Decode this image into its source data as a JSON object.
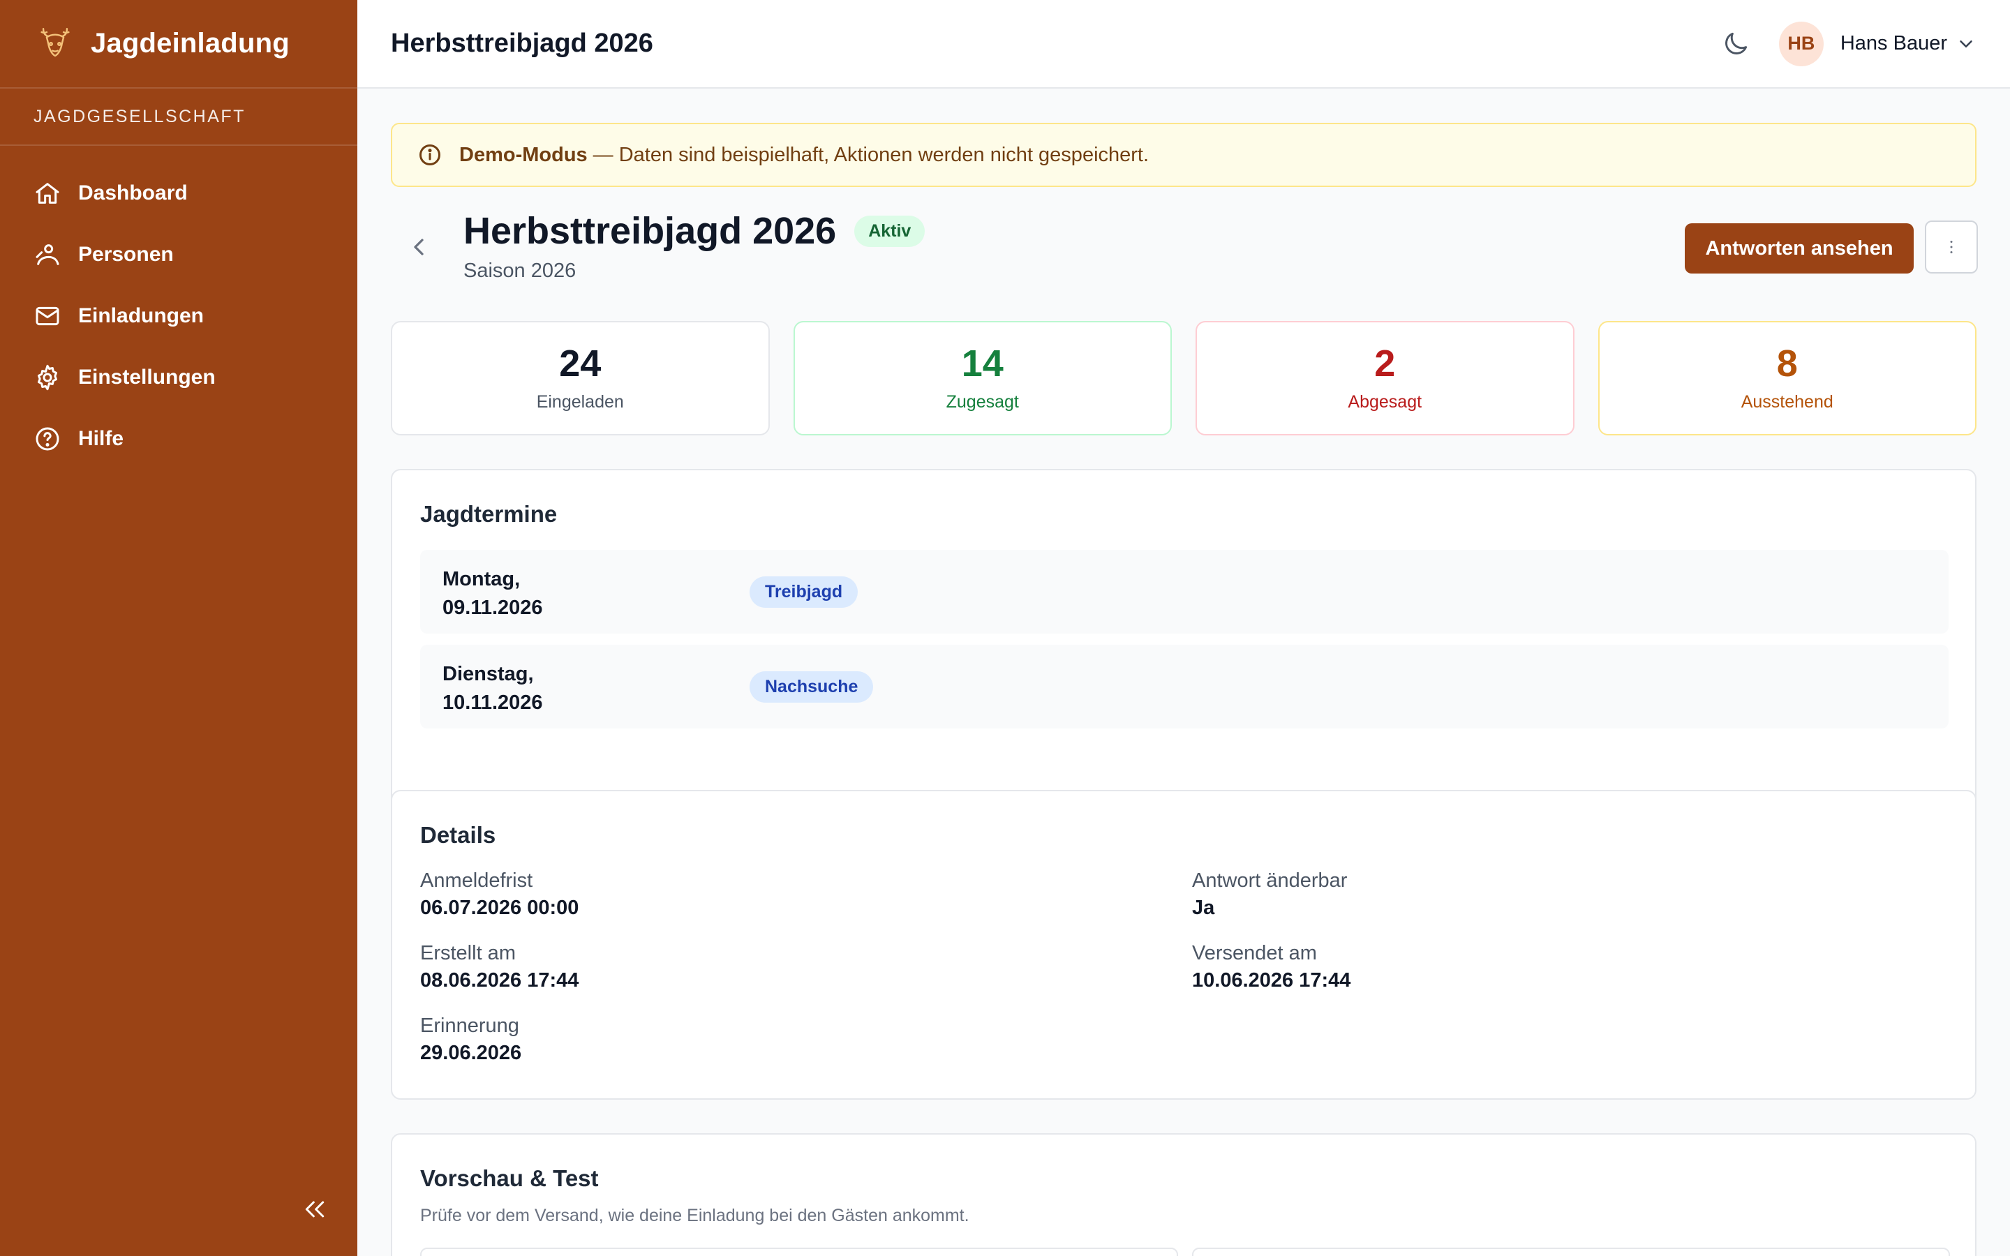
{
  "app": {
    "name": "Jagdeinladung",
    "org_label": "JAGDGESELLSCHAFT"
  },
  "sidebar": {
    "items": [
      {
        "label": "Dashboard",
        "icon": "home-icon"
      },
      {
        "label": "Personen",
        "icon": "people-icon"
      },
      {
        "label": "Einladungen",
        "icon": "mail-icon"
      },
      {
        "label": "Einstellungen",
        "icon": "gear-icon"
      },
      {
        "label": "Hilfe",
        "icon": "help-icon"
      }
    ]
  },
  "topbar": {
    "title": "Herbsttreibjagd 2026",
    "user_initials": "HB",
    "user_name": "Hans Bauer"
  },
  "banner": {
    "strong": "Demo-Modus",
    "text": "— Daten sind beispielhaft, Aktionen werden nicht gespeichert."
  },
  "event": {
    "title": "Herbsttreibjagd 2026",
    "status": "Aktiv",
    "season": "Saison 2026",
    "primary_action": "Antworten ansehen"
  },
  "stats": [
    {
      "value": "24",
      "label": "Eingeladen"
    },
    {
      "value": "14",
      "label": "Zugesagt"
    },
    {
      "value": "2",
      "label": "Abgesagt"
    },
    {
      "value": "8",
      "label": "Ausstehend"
    }
  ],
  "termine": {
    "heading": "Jagdtermine",
    "rows": [
      {
        "day": "Montag,",
        "date": "09.11.2026",
        "type": "Treibjagd"
      },
      {
        "day": "Dienstag,",
        "date": "10.11.2026",
        "type": "Nachsuche"
      }
    ]
  },
  "details": {
    "heading": "Details",
    "fields": [
      {
        "key": "Anmeldefrist",
        "value": "06.07.2026 00:00"
      },
      {
        "key": "Antwort änderbar",
        "value": "Ja"
      },
      {
        "key": "Erstellt am",
        "value": "08.06.2026 17:44"
      },
      {
        "key": "Versendet am",
        "value": "10.06.2026 17:44"
      },
      {
        "key": "Erinnerung",
        "value": "29.06.2026"
      }
    ]
  },
  "preview": {
    "heading": "Vorschau & Test",
    "subtitle": "Prüfe vor dem Versand, wie deine Einladung bei den Gästen ankommt."
  },
  "colors": {
    "brand": "#9a4315",
    "success": "#15803d",
    "danger": "#b91c1c",
    "warning": "#b45309",
    "info_bg": "#fefce8"
  }
}
